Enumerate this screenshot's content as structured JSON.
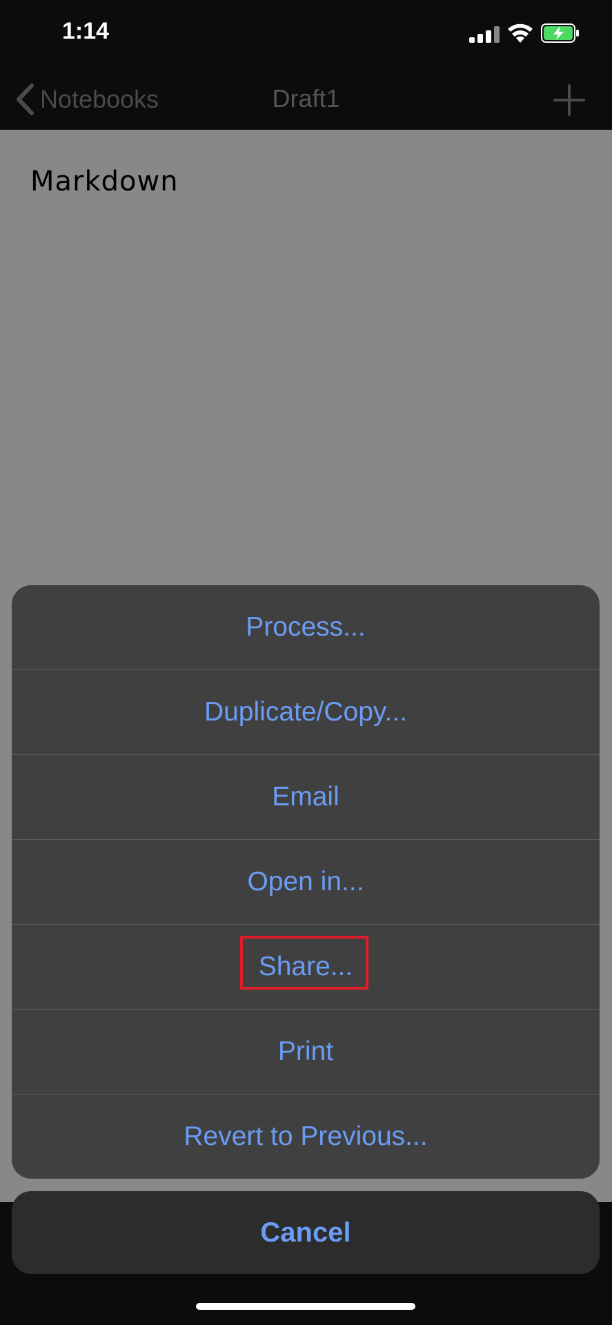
{
  "status_bar": {
    "time": "1:14"
  },
  "nav": {
    "back_label": "Notebooks",
    "title": "Draft1"
  },
  "document": {
    "text": "Markdown"
  },
  "action_sheet": {
    "items": [
      {
        "label": "Process..."
      },
      {
        "label": "Duplicate/Copy..."
      },
      {
        "label": "Email"
      },
      {
        "label": "Open in..."
      },
      {
        "label": "Share..."
      },
      {
        "label": "Print"
      },
      {
        "label": "Revert to Previous..."
      }
    ],
    "cancel_label": "Cancel"
  },
  "colors": {
    "accent": "#6a9cf4",
    "highlight_box": "#e01e2a",
    "battery_fill": "#4cd964"
  }
}
